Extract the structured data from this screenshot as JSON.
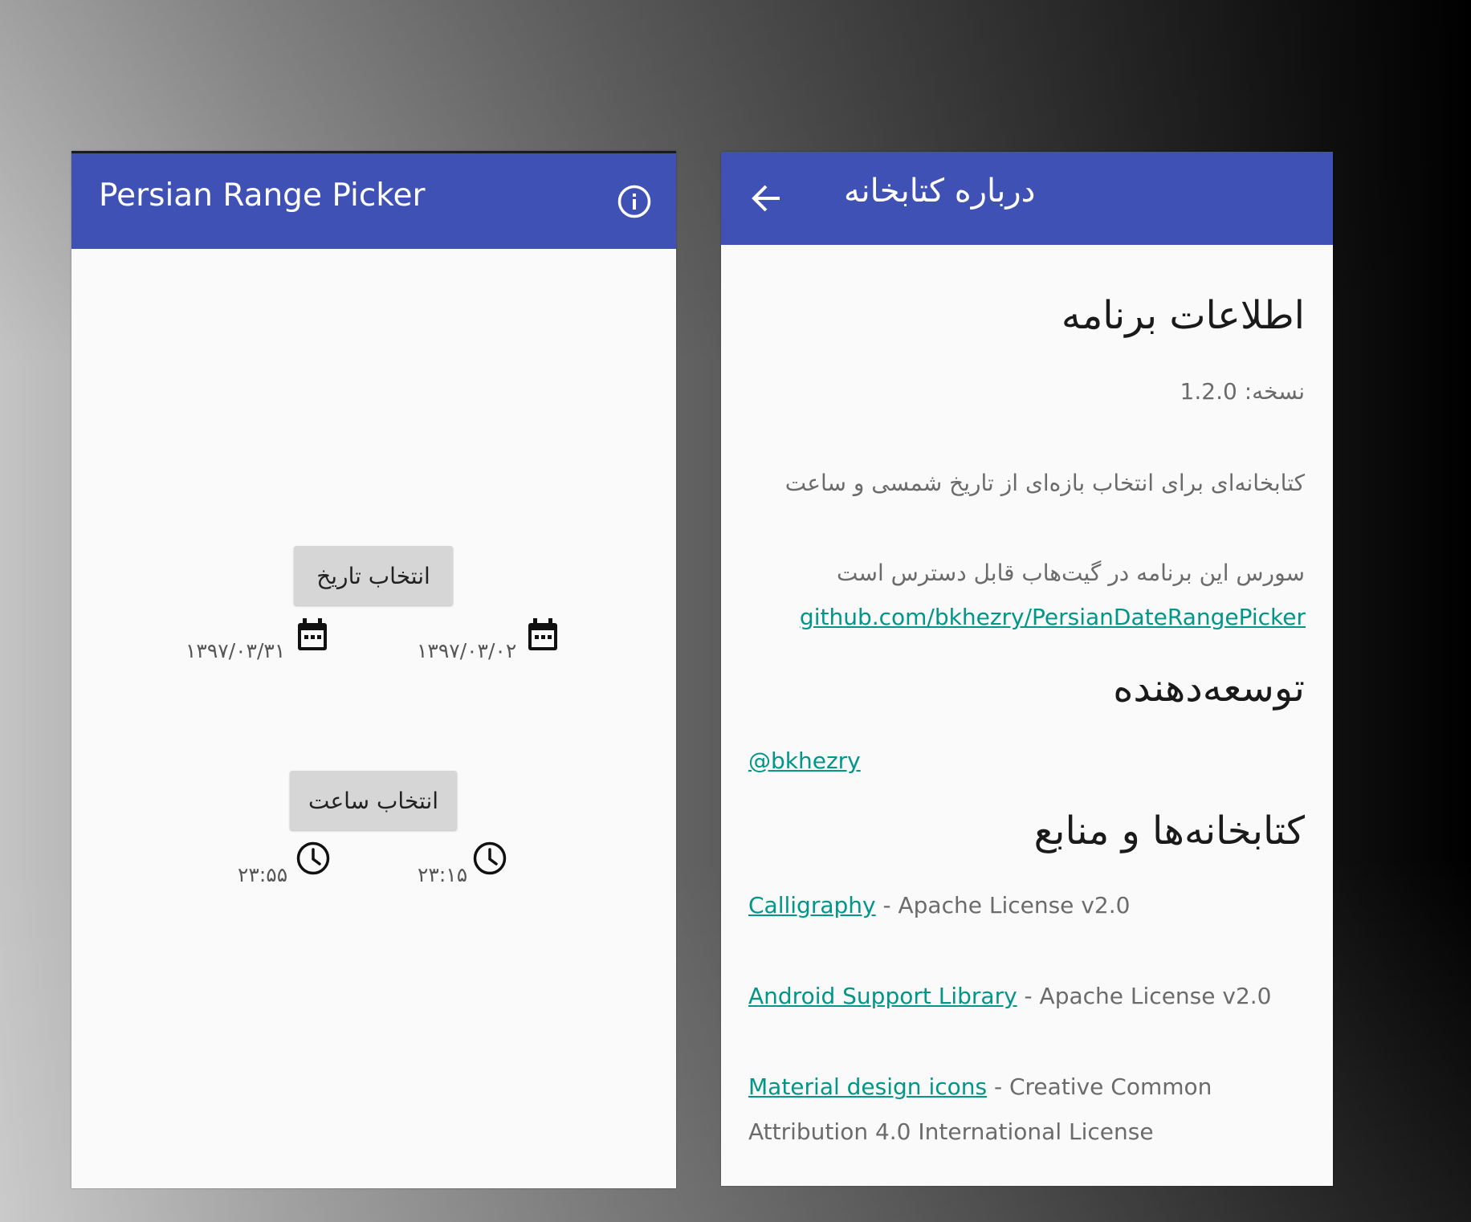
{
  "left_screen": {
    "title": "Persian Range Picker",
    "info_icon": "info-circle-icon",
    "date_button_label": "انتخاب تاریخ",
    "start_date": "۱۳۹۷/۰۳/۰۲",
    "end_date": "۱۳۹۷/۰۳/۳۱",
    "time_button_label": "انتخاب ساعت",
    "start_time": "۲۳:۱۵",
    "end_time": "۲۳:۵۵"
  },
  "right_screen": {
    "title": "درباره کتابخانه",
    "back_icon": "arrow-back-icon",
    "app_info_heading": "اطلاعات برنامه",
    "version": "نسخه: 1.2.0",
    "description": "کتابخانه‌ای برای انتخاب بازه‌ای از تاریخ شمسی و ساعت",
    "source_text": "سورس این برنامه در گیت‌هاب قابل دسترس است",
    "source_link": "github.com/bkhezry/PersianDateRangePicker",
    "developer_heading": "توسعه‌دهنده",
    "developer_link": "@bkhezry",
    "libraries_heading": "کتابخانه‌ها و منابع",
    "libraries": [
      {
        "name": "Calligraphy",
        "license": " - Apache License v2.0"
      },
      {
        "name": "Android Support Library",
        "license": " - Apache License v2.0"
      },
      {
        "name": "Material design icons",
        "license": " - Creative Common",
        "license_line2": "Attribution 4.0 International License"
      }
    ]
  },
  "colors": {
    "app_bar": "#3f51b5",
    "link": "#009688",
    "screen_background": "#fafafa",
    "button": "#d6d6d6"
  }
}
